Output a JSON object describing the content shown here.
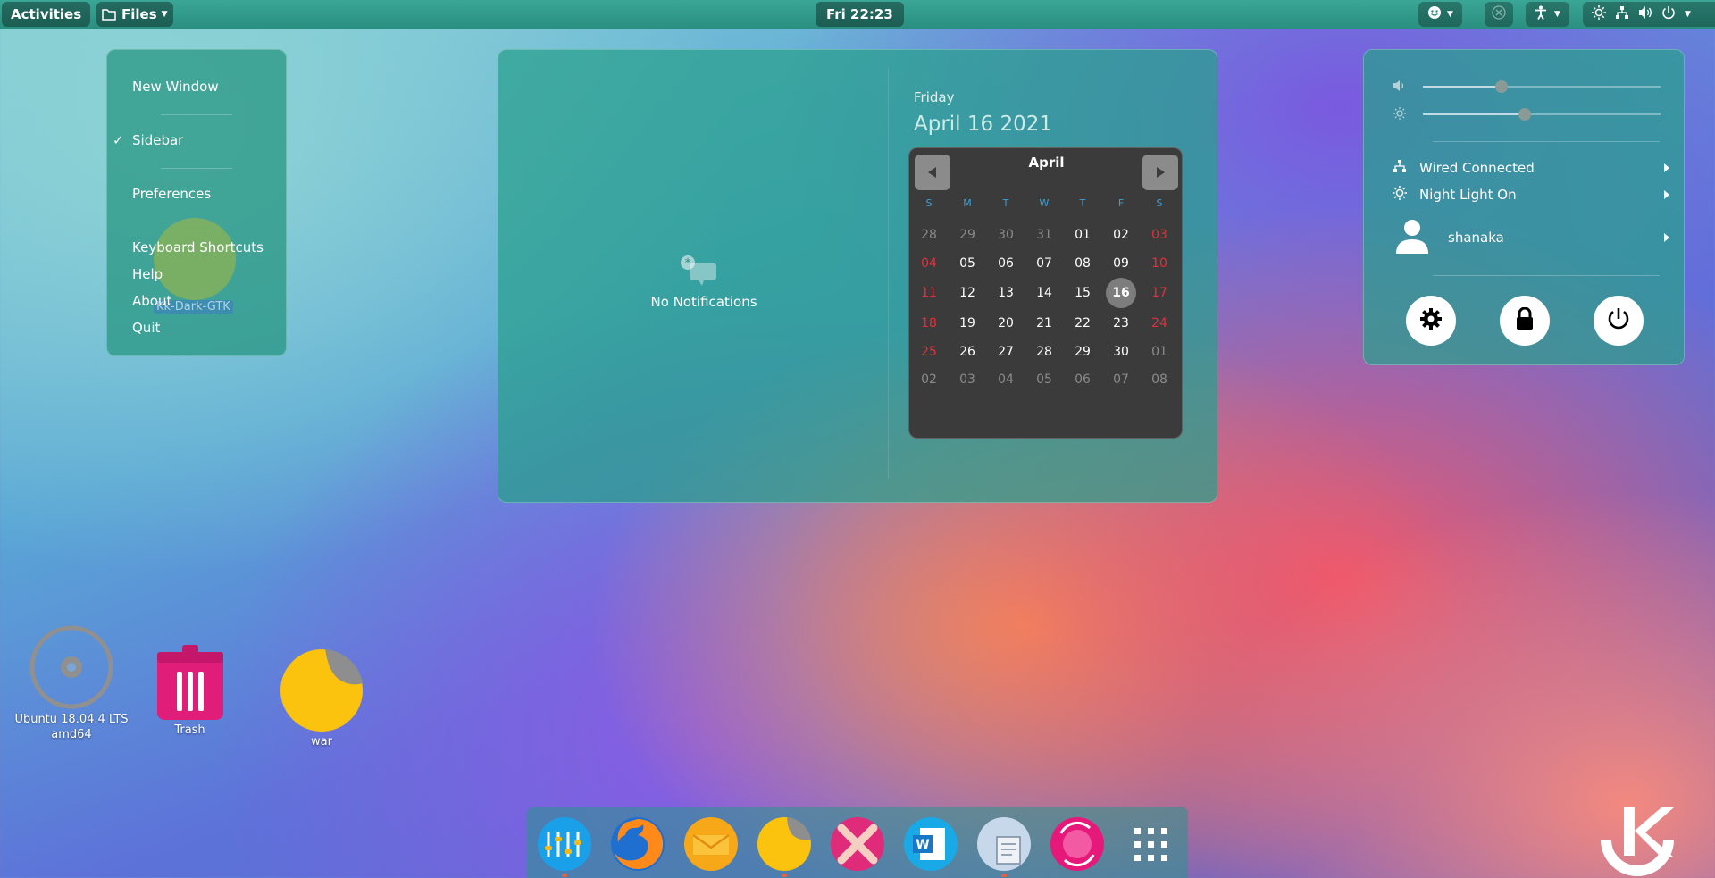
{
  "topbar": {
    "activities": "Activities",
    "files_label": "Files",
    "clock": "Fri 22:23"
  },
  "app_menu": {
    "items": [
      "New Window",
      "Sidebar",
      "Preferences",
      "Keyboard Shortcuts",
      "Help",
      "About",
      "Quit"
    ],
    "checkmark": "✓"
  },
  "desktop_drag_label": "Kk-Dark-GTK",
  "calendar_panel": {
    "no_notifications": "No Notifications",
    "weekday": "Friday",
    "date": "April 16 2021",
    "month": "April",
    "weekday_headers": [
      "S",
      "M",
      "T",
      "W",
      "T",
      "F",
      "S"
    ],
    "weeks": [
      [
        "28",
        "29",
        "30",
        "31",
        "01",
        "02",
        "03"
      ],
      [
        "04",
        "05",
        "06",
        "07",
        "08",
        "09",
        "10"
      ],
      [
        "11",
        "12",
        "13",
        "14",
        "15",
        "16",
        "17"
      ],
      [
        "18",
        "19",
        "20",
        "21",
        "22",
        "23",
        "24"
      ],
      [
        "25",
        "26",
        "27",
        "28",
        "29",
        "30",
        "01"
      ],
      [
        "02",
        "03",
        "04",
        "05",
        "06",
        "07",
        "08"
      ]
    ],
    "today": "16"
  },
  "status_menu": {
    "volume_level": 0.33,
    "brightness_level": 0.43,
    "network": "Wired Connected",
    "night_light": "Night Light On",
    "user": "shanaka"
  },
  "desktop": {
    "disc_label": "Ubuntu 18.04.4 LTS amd64",
    "trash_label": "Trash",
    "war_label": "war"
  },
  "dock": {
    "items": [
      "mixer-app",
      "firefox",
      "mail-app",
      "notes-app",
      "xfig-app",
      "word-app",
      "document-viewer",
      "sync-app",
      "show-applications"
    ]
  },
  "colors": {
    "accent": "#2a9a88",
    "calendar_bg": "#3b3b3b",
    "weekend_red": "#e0313c",
    "weekday_blue": "#3aa0d8"
  }
}
